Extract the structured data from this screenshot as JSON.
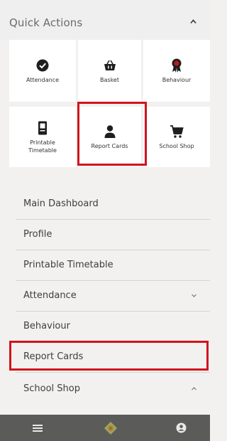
{
  "quick_actions": {
    "title": "Quick Actions",
    "tiles": [
      {
        "label": "Attendance",
        "icon": "check-circle-icon"
      },
      {
        "label": "Basket",
        "icon": "basket-icon"
      },
      {
        "label": "Behaviour",
        "icon": "award-ribbon-icon"
      },
      {
        "label": "Printable\nTimetable",
        "icon": "printable-document-icon"
      },
      {
        "label": "Report Cards",
        "icon": "person-icon",
        "highlighted": true
      },
      {
        "label": "School Shop",
        "icon": "shopping-cart-icon"
      }
    ]
  },
  "menu": {
    "items": [
      {
        "label": "Main Dashboard"
      },
      {
        "label": "Profile"
      },
      {
        "label": "Printable Timetable"
      },
      {
        "label": "Attendance",
        "chevron": "down"
      },
      {
        "label": "Behaviour"
      },
      {
        "label": "Report Cards",
        "highlighted": true
      },
      {
        "label": "School Shop",
        "chevron": "up"
      }
    ]
  },
  "bottom_nav": {
    "items": [
      {
        "icon": "hamburger-menu-icon"
      },
      {
        "icon": "school-logo-icon"
      },
      {
        "icon": "user-account-icon"
      }
    ]
  },
  "colors": {
    "highlight": "#d0141c",
    "bottom_bar": "#5b5c5a",
    "tile_bg": "#ffffff",
    "page_bg": "#f2f1ef"
  }
}
